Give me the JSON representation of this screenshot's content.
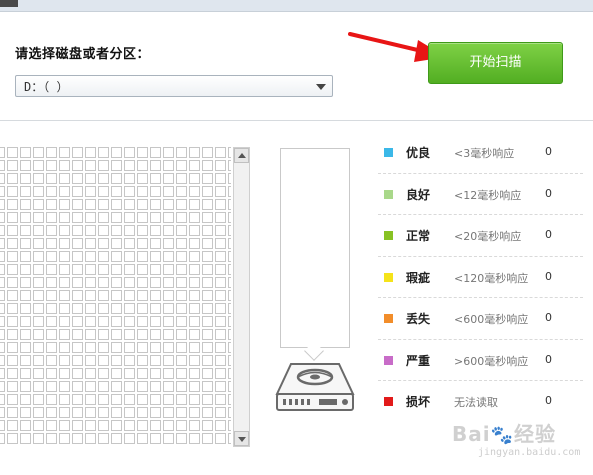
{
  "partition_label": "请选择磁盘或者分区：",
  "drive_select": {
    "value": "D：（        ）"
  },
  "scan_button": {
    "label": "开始扫描"
  },
  "legend": [
    {
      "name": "优良",
      "desc": "<3毫秒响应",
      "count": "0",
      "color": "#3bb8e8"
    },
    {
      "name": "良好",
      "desc": "<12毫秒响应",
      "count": "0",
      "color": "#a9d88a"
    },
    {
      "name": "正常",
      "desc": "<20毫秒响应",
      "count": "0",
      "color": "#88c224"
    },
    {
      "name": "瑕疵",
      "desc": "<120毫秒响应",
      "count": "0",
      "color": "#f5e31a"
    },
    {
      "name": "丢失",
      "desc": "<600毫秒响应",
      "count": "0",
      "color": "#f28d2a"
    },
    {
      "name": "严重",
      "desc": ">600毫秒响应",
      "count": "0",
      "color": "#c86cc8"
    },
    {
      "name": "损坏",
      "desc": "无法读取",
      "count": "0",
      "color": "#e21a1a"
    }
  ],
  "watermark": {
    "text": "Bai",
    "text2": "经验",
    "sub": "jingyan.baidu.com"
  },
  "grid": {
    "rows": 23,
    "cols": 20
  },
  "icons": {
    "disk": "disk-icon",
    "arrow": "red-arrow-pointer",
    "scroll_up": "scroll-up-icon",
    "scroll_down": "scroll-down-icon",
    "dropdown": "chevron-down-icon"
  }
}
